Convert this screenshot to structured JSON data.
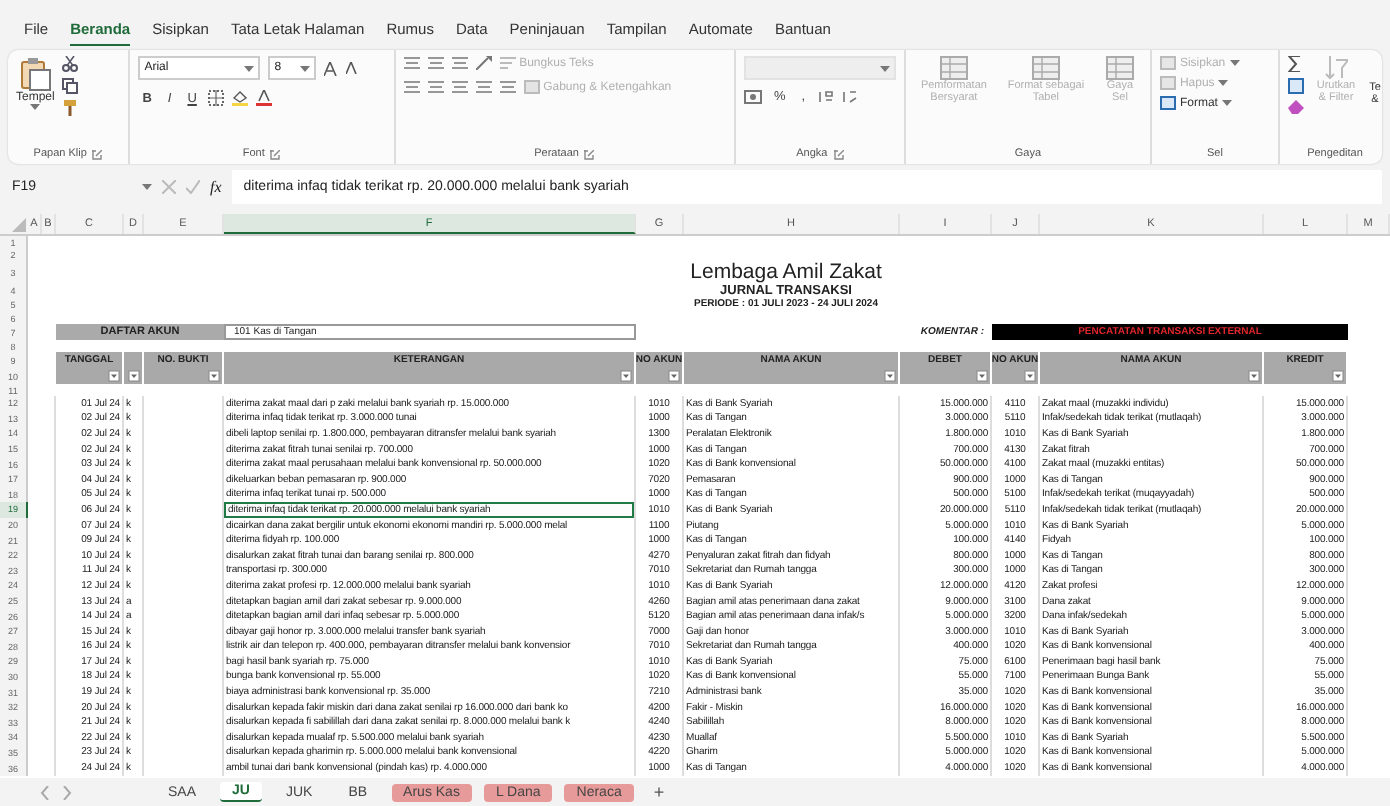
{
  "menu_tabs": [
    {
      "label": "File",
      "selected": false
    },
    {
      "label": "Beranda",
      "selected": true
    },
    {
      "label": "Sisipkan",
      "selected": false
    },
    {
      "label": "Tata Letak Halaman",
      "selected": false
    },
    {
      "label": "Rumus",
      "selected": false
    },
    {
      "label": "Data",
      "selected": false
    },
    {
      "label": "Peninjauan",
      "selected": false
    },
    {
      "label": "Tampilan",
      "selected": false
    },
    {
      "label": "Automate",
      "selected": false
    },
    {
      "label": "Bantuan",
      "selected": false
    }
  ],
  "ribbon": {
    "clipboard": {
      "paste": "Tempel",
      "group": "Papan Klip"
    },
    "font": {
      "name": "Arial",
      "size": "8",
      "buttons": [
        "B",
        "I",
        "U"
      ],
      "group": "Font"
    },
    "alignment": {
      "wrap": {
        "label": "Bungkus Teks",
        "disabled": true
      },
      "merge": {
        "label": "Gabung & Ketengahkan",
        "disabled": true
      },
      "group": "Perataan"
    },
    "number": {
      "buttons": [
        "%",
        ","
      ],
      "group": "Angka"
    },
    "styles": {
      "items": [
        {
          "label": "Pemformatan Bersyarat",
          "disabled": true
        },
        {
          "label": "Format sebagai Tabel",
          "disabled": true
        },
        {
          "label": "Gaya Sel",
          "disabled": true
        }
      ],
      "group": "Gaya"
    },
    "cells": {
      "items": [
        {
          "label": "Sisipkan",
          "disabled": true
        },
        {
          "label": "Hapus",
          "disabled": true
        },
        {
          "label": "Format",
          "disabled": false
        }
      ],
      "group": "Sel"
    },
    "editing": {
      "sort": {
        "label": "Urutkan & Filter",
        "disabled": true
      },
      "find": "Te &",
      "group": "Pengeditan"
    }
  },
  "formula_bar": {
    "name_box": "F19",
    "fx": "fx",
    "formula": "diterima infaq tidak terikat rp. 20.000.000 melalui bank syariah"
  },
  "columns": [
    {
      "label": "A",
      "selected": false
    },
    {
      "label": "B",
      "selected": false
    },
    {
      "label": "C",
      "selected": false
    },
    {
      "label": "D",
      "selected": false
    },
    {
      "label": "E",
      "selected": false
    },
    {
      "label": "F",
      "selected": true
    },
    {
      "label": "G",
      "selected": false
    },
    {
      "label": "H",
      "selected": false
    },
    {
      "label": "I",
      "selected": false
    },
    {
      "label": "J",
      "selected": false
    },
    {
      "label": "K",
      "selected": false
    },
    {
      "label": "L",
      "selected": false
    },
    {
      "label": "M",
      "selected": false
    }
  ],
  "sheet": {
    "title": "Lembaga Amil Zakat",
    "subtitle": "JURNAL TRANSAKSI",
    "period": "PERIODE : 01 JULI 2023 - 24 JULI 2024",
    "account_label": "DAFTAR AKUN",
    "account_value": "101  Kas di Tangan",
    "comment_label": "KOMENTAR :",
    "comment_value": "PENCATATAN TRANSAKSI EXTERNAL",
    "headers": [
      "TANGGAL",
      "NO. BUKTI",
      "KETERANGAN",
      "NO AKUN",
      "NAMA AKUN",
      "DEBET",
      "NO AKUN",
      "NAMA AKUN",
      "KREDIT"
    ],
    "rows": [
      {
        "number": "1",
        "kind": "blank"
      },
      {
        "number": "2",
        "kind": "blank"
      },
      {
        "number": "3",
        "kind": "title"
      },
      {
        "number": "4",
        "kind": "subtitle"
      },
      {
        "number": "5",
        "kind": "period"
      },
      {
        "number": "6",
        "kind": "blank"
      },
      {
        "number": "7",
        "kind": "account"
      },
      {
        "number": "8",
        "kind": "blank"
      },
      {
        "number": "9",
        "kind": "header"
      },
      {
        "number": "10",
        "kind": "filter"
      },
      {
        "number": "11",
        "kind": "blank"
      },
      {
        "number": "12",
        "kind": "entry",
        "selected": false,
        "date": "01 Jul 24",
        "code": "k",
        "description": "diterima zakat maal dari p zaki melalui bank syariah rp. 15.000.000",
        "debit_account": "1010",
        "debit_name": "Kas di Bank Syariah",
        "debit": "15.000.000",
        "credit_account": "4110",
        "credit_name": "Zakat maal (muzakki individu)",
        "credit": "15.000.000"
      },
      {
        "number": "13",
        "kind": "entry",
        "selected": false,
        "date": "02 Jul 24",
        "code": "k",
        "description": "diterima infaq tidak terikat rp. 3.000.000 tunai",
        "debit_account": "1000",
        "debit_name": "Kas di Tangan",
        "debit": "3.000.000",
        "credit_account": "5110",
        "credit_name": "Infak/sedekah tidak terikat (mutlaqah)",
        "credit": "3.000.000"
      },
      {
        "number": "14",
        "kind": "entry",
        "selected": false,
        "date": "02 Jul 24",
        "code": "k",
        "description": "dibeli laptop senilai rp. 1.800.000, pembayaran ditransfer melalui bank syariah",
        "debit_account": "1300",
        "debit_name": "Peralatan Elektronik",
        "debit": "1.800.000",
        "credit_account": "1010",
        "credit_name": "Kas di Bank Syariah",
        "credit": "1.800.000"
      },
      {
        "number": "15",
        "kind": "entry",
        "selected": false,
        "date": "02 Jul 24",
        "code": "k",
        "description": "diterima zakat fitrah tunai senilai rp. 700.000",
        "debit_account": "1000",
        "debit_name": "Kas di Tangan",
        "debit": "700.000",
        "credit_account": "4130",
        "credit_name": "Zakat fitrah",
        "credit": "700.000"
      },
      {
        "number": "16",
        "kind": "entry",
        "selected": false,
        "date": "03 Jul 24",
        "code": "k",
        "description": "diterima zakat maal perusahaan melalui bank konvensional rp. 50.000.000",
        "debit_account": "1020",
        "debit_name": "Kas di Bank konvensional",
        "debit": "50.000.000",
        "credit_account": "4100",
        "credit_name": "Zakat maal (muzakki entitas)",
        "credit": "50.000.000"
      },
      {
        "number": "17",
        "kind": "entry",
        "selected": false,
        "date": "04 Jul 24",
        "code": "k",
        "description": "dikeluarkan beban pemasaran rp. 900.000",
        "debit_account": "7020",
        "debit_name": "Pemasaran",
        "debit": "900.000",
        "credit_account": "1000",
        "credit_name": "Kas di Tangan",
        "credit": "900.000"
      },
      {
        "number": "18",
        "kind": "entry",
        "selected": false,
        "date": "05 Jul 24",
        "code": "k",
        "description": "diterima infaq terikat tunai rp. 500.000",
        "debit_account": "1000",
        "debit_name": "Kas di Tangan",
        "debit": "500.000",
        "credit_account": "5100",
        "credit_name": "Infak/sedekah terikat (muqayyadah)",
        "credit": "500.000"
      },
      {
        "number": "19",
        "kind": "entry",
        "selected": true,
        "date": "06 Jul 24",
        "code": "k",
        "description": "diterima infaq tidak terikat rp. 20.000.000 melalui bank syariah",
        "debit_account": "1010",
        "debit_name": "Kas di Bank Syariah",
        "debit": "20.000.000",
        "credit_account": "5110",
        "credit_name": "Infak/sedekah tidak terikat (mutlaqah)",
        "credit": "20.000.000"
      },
      {
        "number": "20",
        "kind": "entry",
        "selected": false,
        "date": "07 Jul 24",
        "code": "k",
        "description": "dicairkan dana zakat bergilir untuk ekonomi ekonomi mandiri rp. 5.000.000 melal",
        "debit_account": "1100",
        "debit_name": "Piutang",
        "debit": "5.000.000",
        "credit_account": "1010",
        "credit_name": "Kas di Bank Syariah",
        "credit": "5.000.000"
      },
      {
        "number": "21",
        "kind": "entry",
        "selected": false,
        "date": "09 Jul 24",
        "code": "k",
        "description": "diterima fidyah rp. 100.000",
        "debit_account": "1000",
        "debit_name": "Kas di Tangan",
        "debit": "100.000",
        "credit_account": "4140",
        "credit_name": "Fidyah",
        "credit": "100.000"
      },
      {
        "number": "22",
        "kind": "entry",
        "selected": false,
        "date": "10 Jul 24",
        "code": "k",
        "description": "disalurkan zakat fitrah  tunai dan barang senilai rp. 800.000",
        "debit_account": "4270",
        "debit_name": "Penyaluran zakat fitrah dan fidyah",
        "debit": "800.000",
        "credit_account": "1000",
        "credit_name": "Kas di Tangan",
        "credit": "800.000"
      },
      {
        "number": "23",
        "kind": "entry",
        "selected": false,
        "date": "11 Jul 24",
        "code": "k",
        "description": "transportasi rp. 300.000",
        "debit_account": "7010",
        "debit_name": "Sekretariat dan Rumah tangga",
        "debit": "300.000",
        "credit_account": "1000",
        "credit_name": "Kas di Tangan",
        "credit": "300.000"
      },
      {
        "number": "24",
        "kind": "entry",
        "selected": false,
        "date": "12 Jul 24",
        "code": "k",
        "description": "diterima zakat profesi rp. 12.000.000 melalui bank syariah",
        "debit_account": "1010",
        "debit_name": "Kas di Bank Syariah",
        "debit": "12.000.000",
        "credit_account": "4120",
        "credit_name": "Zakat profesi",
        "credit": "12.000.000"
      },
      {
        "number": "25",
        "kind": "entry",
        "selected": false,
        "date": "13 Jul 24",
        "code": "a",
        "description": "ditetapkan bagian amil dari zakat sebesar rp. 9.000.000",
        "debit_account": "4260",
        "debit_name": "Bagian amil atas penerimaan dana zakat",
        "debit": "9.000.000",
        "credit_account": "3100",
        "credit_name": "Dana zakat",
        "credit": "9.000.000"
      },
      {
        "number": "26",
        "kind": "entry",
        "selected": false,
        "date": "14 Jul 24",
        "code": "a",
        "description": "ditetapkan bagian amil dari infaq sebesar rp. 5.000.000",
        "debit_account": "5120",
        "debit_name": "Bagian amil atas penerimaan dana infak/s",
        "debit": "5.000.000",
        "credit_account": "3200",
        "credit_name": "Dana infak/sedekah",
        "credit": "5.000.000"
      },
      {
        "number": "27",
        "kind": "entry",
        "selected": false,
        "date": "15 Jul 24",
        "code": "k",
        "description": "dibayar gaji honor rp. 3.000.000 melalui transfer bank syariah",
        "debit_account": "7000",
        "debit_name": "Gaji dan honor",
        "debit": "3.000.000",
        "credit_account": "1010",
        "credit_name": "Kas di Bank Syariah",
        "credit": "3.000.000"
      },
      {
        "number": "28",
        "kind": "entry",
        "selected": false,
        "date": "16 Jul 24",
        "code": "k",
        "description": "listrik air dan telepon rp. 400.000, pembayaran ditransfer melalui bank konvensior",
        "debit_account": "7010",
        "debit_name": "Sekretariat dan Rumah tangga",
        "debit": "400.000",
        "credit_account": "1020",
        "credit_name": "Kas di Bank konvensional",
        "credit": "400.000"
      },
      {
        "number": "29",
        "kind": "entry",
        "selected": false,
        "date": "17 Jul 24",
        "code": "k",
        "description": "bagi hasil bank syariah rp. 75.000",
        "debit_account": "1010",
        "debit_name": "Kas di Bank Syariah",
        "debit": "75.000",
        "credit_account": "6100",
        "credit_name": "Penerimaan bagi hasil bank",
        "credit": "75.000"
      },
      {
        "number": "30",
        "kind": "entry",
        "selected": false,
        "date": "18 Jul 24",
        "code": "k",
        "description": "bunga bank konvensional rp. 55.000",
        "debit_account": "1020",
        "debit_name": "Kas di Bank konvensional",
        "debit": "55.000",
        "credit_account": "7100",
        "credit_name": "Penerimaan Bunga Bank",
        "credit": "55.000"
      },
      {
        "number": "31",
        "kind": "entry",
        "selected": false,
        "date": "19 Jul 24",
        "code": "k",
        "description": "biaya administrasi bank konvensional rp. 35.000",
        "debit_account": "7210",
        "debit_name": "Administrasi bank",
        "debit": "35.000",
        "credit_account": "1020",
        "credit_name": "Kas di Bank konvensional",
        "credit": "35.000"
      },
      {
        "number": "32",
        "kind": "entry",
        "selected": false,
        "date": "20 Jul 24",
        "code": "k",
        "description": "disalurkan kepada fakir miskin dari dana zakat senilai rp 16.000.000 dari bank ko",
        "debit_account": "4200",
        "debit_name": "Fakir - Miskin",
        "debit": "16.000.000",
        "credit_account": "1020",
        "credit_name": "Kas di Bank konvensional",
        "credit": "16.000.000"
      },
      {
        "number": "33",
        "kind": "entry",
        "selected": false,
        "date": "21 Jul 24",
        "code": "k",
        "description": "disalurkan kepada fi sabilillah dari dana zakat senilai rp. 8.000.000 melalui bank k",
        "debit_account": "4240",
        "debit_name": "Sabilillah",
        "debit": "8.000.000",
        "credit_account": "1020",
        "credit_name": "Kas di Bank konvensional",
        "credit": "8.000.000"
      },
      {
        "number": "34",
        "kind": "entry",
        "selected": false,
        "date": "22 Jul 24",
        "code": "k",
        "description": "disalurkan kepada mualaf rp. 5.500.000 melalui bank syariah",
        "debit_account": "4230",
        "debit_name": "Muallaf",
        "debit": "5.500.000",
        "credit_account": "1010",
        "credit_name": "Kas di Bank Syariah",
        "credit": "5.500.000"
      },
      {
        "number": "35",
        "kind": "entry",
        "selected": false,
        "date": "23 Jul 24",
        "code": "k",
        "description": "disalurkan kepada gharimin rp. 5.000.000 melalui bank konvensional",
        "debit_account": "4220",
        "debit_name": "Gharim",
        "debit": "5.000.000",
        "credit_account": "1020",
        "credit_name": "Kas di Bank konvensional",
        "credit": "5.000.000"
      },
      {
        "number": "36",
        "kind": "entry",
        "selected": false,
        "date": "24 Jul 24",
        "code": "k",
        "description": "ambil tunai dari bank konvensional (pindah kas) rp. 4.000.000",
        "debit_account": "1000",
        "debit_name": "Kas di Tangan",
        "debit": "4.000.000",
        "credit_account": "1020",
        "credit_name": "Kas di Bank konvensional",
        "credit": "4.000.000"
      }
    ]
  },
  "sheet_tabs": [
    {
      "label": "SAA",
      "selected": false
    },
    {
      "label": "JU",
      "selected": true
    },
    {
      "label": "JUK",
      "selected": false
    },
    {
      "label": "BB",
      "selected": false
    },
    {
      "label": "Arus Kas",
      "selected": false,
      "color": "#e79a9a"
    },
    {
      "label": "L Dana",
      "selected": false,
      "color": "#e79a9a"
    },
    {
      "label": "Neraca",
      "selected": false,
      "color": "#e79a9a"
    }
  ],
  "add_sheet": "+"
}
